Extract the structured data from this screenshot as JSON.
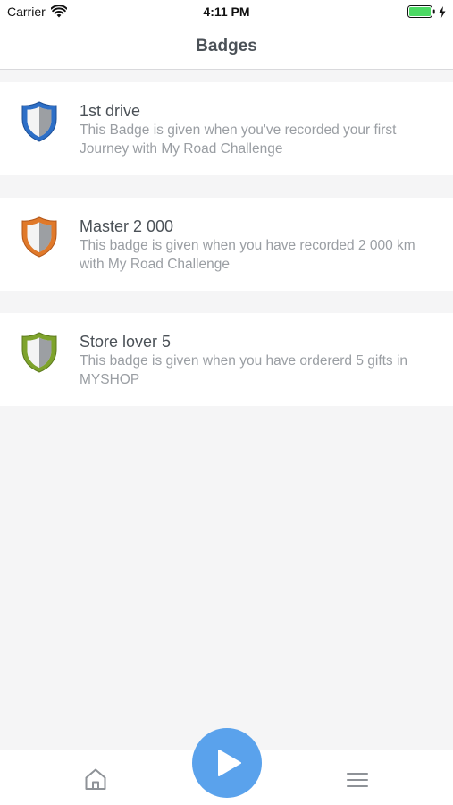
{
  "status_bar": {
    "carrier": "Carrier",
    "time": "4:11 PM",
    "wifi_icon": "wifi-icon",
    "battery_icon": "battery-icon",
    "charging_icon": "bolt-icon",
    "battery_color": "#4cd964"
  },
  "nav": {
    "title": "Badges"
  },
  "badges": [
    {
      "name": "1st drive",
      "description": "This Badge is given when you've recorded your first Journey with My Road Challenge",
      "icon": "blue-shield-icon",
      "color": "#2d6fc7"
    },
    {
      "name": "Master 2 000",
      "description": "This badge is given when you have recorded 2 000 km with My Road Challenge",
      "icon": "orange-shield-icon",
      "color": "#e0792a"
    },
    {
      "name": "Store lover 5",
      "description": "This badge is given when you have ordererd 5 gifts in MYSHOP",
      "icon": "green-shield-icon",
      "color": "#7ea32c"
    }
  ],
  "tab_bar": {
    "home_icon": "home-icon",
    "play_icon": "play-icon",
    "menu_icon": "hamburger-menu-icon",
    "play_button_color": "#5aa2ec"
  }
}
